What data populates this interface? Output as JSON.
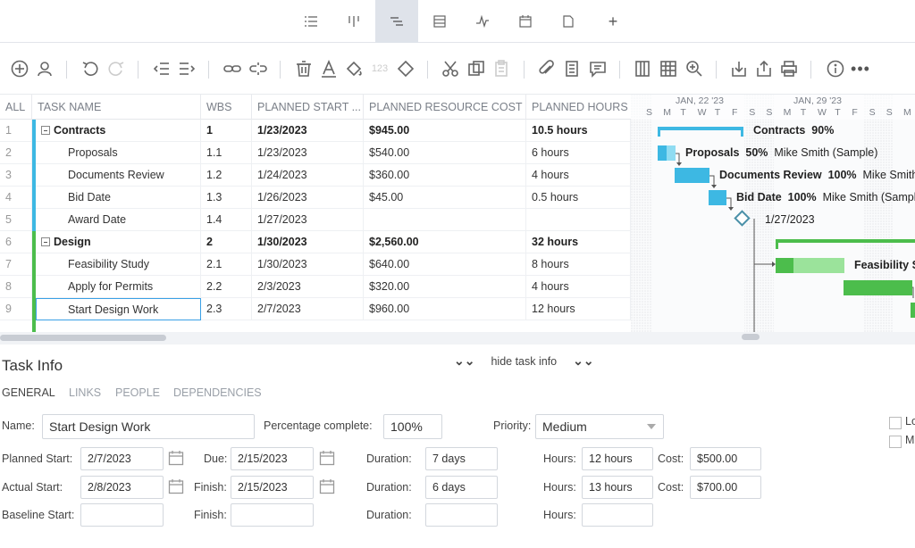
{
  "view_tabs": [
    {
      "name": "list-view-tab",
      "icon": "☰"
    },
    {
      "name": "board-view-tab",
      "icon": "⫼"
    },
    {
      "name": "gantt-view-tab",
      "icon": "≡",
      "active": true
    },
    {
      "name": "sheet-view-tab",
      "icon": "▤"
    },
    {
      "name": "dashboard-view-tab",
      "icon": "∿"
    },
    {
      "name": "calendar-view-tab",
      "icon": "▦"
    },
    {
      "name": "reports-view-tab",
      "icon": "▯"
    },
    {
      "name": "add-view-tab",
      "icon": "+"
    }
  ],
  "grid": {
    "headers": {
      "all": "ALL",
      "task": "TASK NAME",
      "wbs": "WBS",
      "start": "PLANNED START ...",
      "cost": "PLANNED RESOURCE COST",
      "hours": "PLANNED HOURS"
    },
    "rows": [
      {
        "n": "1",
        "task": "Contracts",
        "wbs": "1",
        "start": "1/23/2023",
        "cost": "$945.00",
        "hours": "10.5 hours",
        "group": true,
        "color": "#3db8e3"
      },
      {
        "n": "2",
        "task": "Proposals",
        "wbs": "1.1",
        "start": "1/23/2023",
        "cost": "$540.00",
        "hours": "6 hours",
        "color": "#3db8e3"
      },
      {
        "n": "3",
        "task": "Documents Review",
        "wbs": "1.2",
        "start": "1/24/2023",
        "cost": "$360.00",
        "hours": "4 hours",
        "color": "#3db8e3"
      },
      {
        "n": "4",
        "task": "Bid Date",
        "wbs": "1.3",
        "start": "1/26/2023",
        "cost": "$45.00",
        "hours": "0.5 hours",
        "color": "#3db8e3"
      },
      {
        "n": "5",
        "task": "Award Date",
        "wbs": "1.4",
        "start": "1/27/2023",
        "cost": "",
        "hours": "",
        "color": "#3db8e3"
      },
      {
        "n": "6",
        "task": "Design",
        "wbs": "2",
        "start": "1/30/2023",
        "cost": "$2,560.00",
        "hours": "32 hours",
        "group": true,
        "color": "#4cbd4c"
      },
      {
        "n": "7",
        "task": "Feasibility Study",
        "wbs": "2.1",
        "start": "1/30/2023",
        "cost": "$640.00",
        "hours": "8 hours",
        "color": "#4cbd4c"
      },
      {
        "n": "8",
        "task": "Apply for Permits",
        "wbs": "2.2",
        "start": "2/3/2023",
        "cost": "$320.00",
        "hours": "4 hours",
        "color": "#4cbd4c"
      },
      {
        "n": "9",
        "task": "Start Design Work",
        "wbs": "2.3",
        "start": "2/7/2023",
        "cost": "$960.00",
        "hours": "12 hours",
        "color": "#4cbd4c",
        "selected": true
      }
    ]
  },
  "gantt": {
    "weeks": [
      "JAN, 22 '23",
      "JAN, 29 '23"
    ],
    "days": [
      "S",
      "M",
      "T",
      "W",
      "T",
      "F",
      "S",
      "S",
      "M",
      "T",
      "W",
      "T",
      "F",
      "S",
      "S",
      "M"
    ],
    "labels": {
      "contracts": "Contracts",
      "contracts_pct": "90%",
      "proposals": "Proposals",
      "proposals_pct": "50%",
      "proposals_res": "Mike Smith (Sample)",
      "docs": "Documents Review",
      "docs_pct": "100%",
      "docs_res": "Mike Smith",
      "bid": "Bid Date",
      "bid_pct": "100%",
      "bid_res": "Mike Smith (Sample)",
      "award": "1/27/2023",
      "feas": "Feasibility S"
    }
  },
  "task_info": {
    "title": "Task Info",
    "toggle": "hide task info",
    "tabs": [
      "GENERAL",
      "LINKS",
      "PEOPLE",
      "DEPENDENCIES"
    ],
    "name_label": "Name:",
    "name": "Start Design Work",
    "pct_label": "Percentage complete:",
    "pct": "100%",
    "priority_label": "Priority:",
    "priority": "Medium",
    "planned_start_label": "Planned Start:",
    "planned_start": "2/7/2023",
    "due_label": "Due:",
    "due": "2/15/2023",
    "duration_label": "Duration:",
    "planned_duration": "7 days",
    "hours_label": "Hours:",
    "planned_hours": "12 hours",
    "cost_label": "Cost:",
    "planned_cost": "$500.00",
    "actual_start_label": "Actual Start:",
    "actual_start": "2/8/2023",
    "finish_label": "Finish:",
    "actual_finish": "2/15/2023",
    "actual_duration": "6 days",
    "actual_hours": "13 hours",
    "actual_cost": "$700.00",
    "baseline_start_label": "Baseline Start:",
    "check1": "Lo",
    "check2": "M"
  },
  "colors": {
    "blue": "#3db8e3",
    "blue_light": "#8fdcf2",
    "green": "#4cbd4c",
    "green_light": "#9be39b",
    "active_tab": "#dfe3ea",
    "selection": "#3aa0e6"
  }
}
